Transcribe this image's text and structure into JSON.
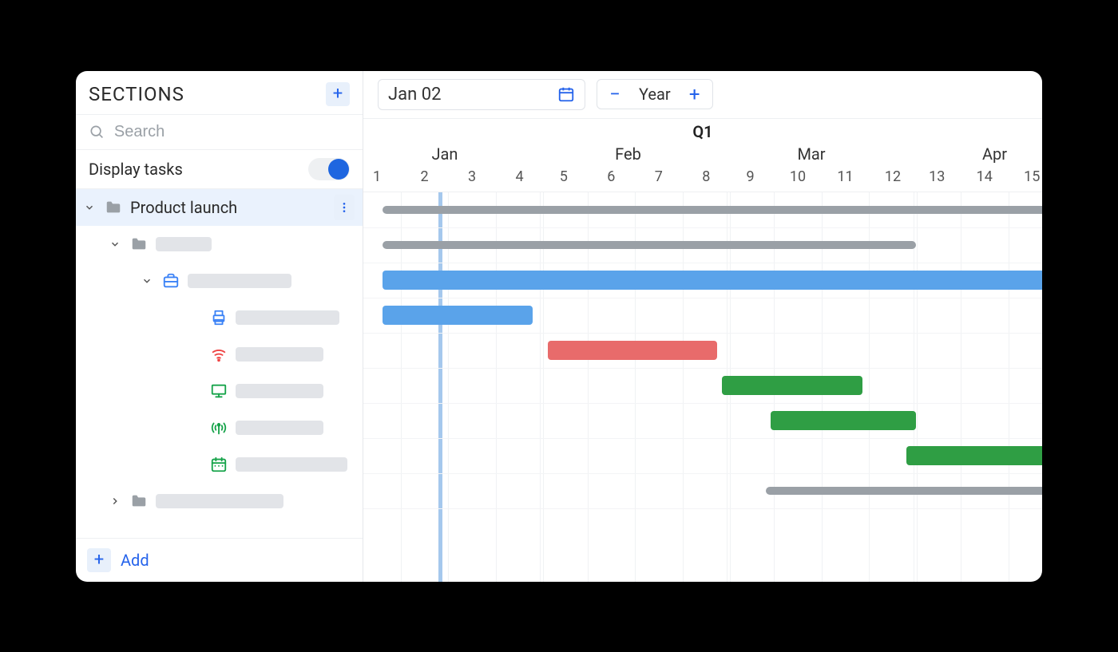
{
  "sidebar": {
    "title": "SECTIONS",
    "search_placeholder": "Search",
    "display_tasks_label": "Display tasks",
    "display_tasks_on": true,
    "tree": [
      {
        "indent": 0,
        "icon": "folder",
        "icon_color": "#9aa0a6",
        "label": "Product launch",
        "expanded": true,
        "selected": true,
        "has_more": true
      },
      {
        "indent": 1,
        "icon": "folder",
        "icon_color": "#9aa0a6",
        "placeholder_width": 70,
        "expanded": true
      },
      {
        "indent": 2,
        "icon": "briefcase",
        "icon_color": "#3b82f6",
        "placeholder_width": 130,
        "expanded": true
      },
      {
        "indent": 3,
        "icon": "printer",
        "icon_color": "#3b82f6",
        "placeholder_width": 130
      },
      {
        "indent": 3,
        "icon": "wifi",
        "icon_color": "#ef4444",
        "placeholder_width": 110
      },
      {
        "indent": 3,
        "icon": "monitor",
        "icon_color": "#16a34a",
        "placeholder_width": 110
      },
      {
        "indent": 3,
        "icon": "antenna",
        "icon_color": "#16a34a",
        "placeholder_width": 110
      },
      {
        "indent": 3,
        "icon": "calendar",
        "icon_color": "#16a34a",
        "placeholder_width": 140
      },
      {
        "indent": 1,
        "icon": "folder",
        "icon_color": "#9aa0a6",
        "placeholder_width": 160,
        "expanded": false
      }
    ],
    "add_label": "Add"
  },
  "toolbar": {
    "date_label": "Jan 02",
    "zoom_label": "Year"
  },
  "timeline": {
    "quarter": "Q1",
    "months": [
      {
        "label": "Jan",
        "pos": 12
      },
      {
        "label": "Feb",
        "pos": 39
      },
      {
        "label": "Mar",
        "pos": 66
      },
      {
        "label": "Apr",
        "pos": 93
      }
    ],
    "weeks": [
      {
        "n": "1",
        "pos": 2
      },
      {
        "n": "2",
        "pos": 9
      },
      {
        "n": "3",
        "pos": 16
      },
      {
        "n": "4",
        "pos": 23
      },
      {
        "n": "5",
        "pos": 29.5
      },
      {
        "n": "6",
        "pos": 36.5
      },
      {
        "n": "7",
        "pos": 43.5
      },
      {
        "n": "8",
        "pos": 50.5
      },
      {
        "n": "9",
        "pos": 57
      },
      {
        "n": "10",
        "pos": 64
      },
      {
        "n": "11",
        "pos": 71
      },
      {
        "n": "12",
        "pos": 78
      },
      {
        "n": "13",
        "pos": 84.5
      },
      {
        "n": "14",
        "pos": 91.5
      },
      {
        "n": "15",
        "pos": 98.5
      }
    ],
    "today_pos": 11
  },
  "chart_data": {
    "type": "gantt",
    "time_unit": "week",
    "x_range": [
      1,
      15
    ],
    "rows": [
      {
        "kind": "summary",
        "start": 1.4,
        "end": 15.5,
        "color": "gray"
      },
      {
        "kind": "summary",
        "start": 1.4,
        "end": 12.4,
        "color": "gray"
      },
      {
        "kind": "task",
        "start": 1.4,
        "end": 15.5,
        "color": "blue"
      },
      {
        "kind": "task",
        "start": 1.4,
        "end": 4.5,
        "color": "blue"
      },
      {
        "kind": "task",
        "start": 4.8,
        "end": 8.3,
        "color": "red"
      },
      {
        "kind": "task",
        "start": 8.4,
        "end": 11.3,
        "color": "green"
      },
      {
        "kind": "task",
        "start": 9.4,
        "end": 12.4,
        "color": "green"
      },
      {
        "kind": "task",
        "start": 12.2,
        "end": 15.5,
        "color": "green"
      },
      {
        "kind": "summary",
        "start": 9.3,
        "end": 15.5,
        "color": "gray"
      }
    ]
  },
  "colors": {
    "accent": "#2563eb",
    "blue": "#5aa3ea",
    "red": "#e86b6b",
    "green": "#2f9e44",
    "gray": "#9aa0a6"
  }
}
